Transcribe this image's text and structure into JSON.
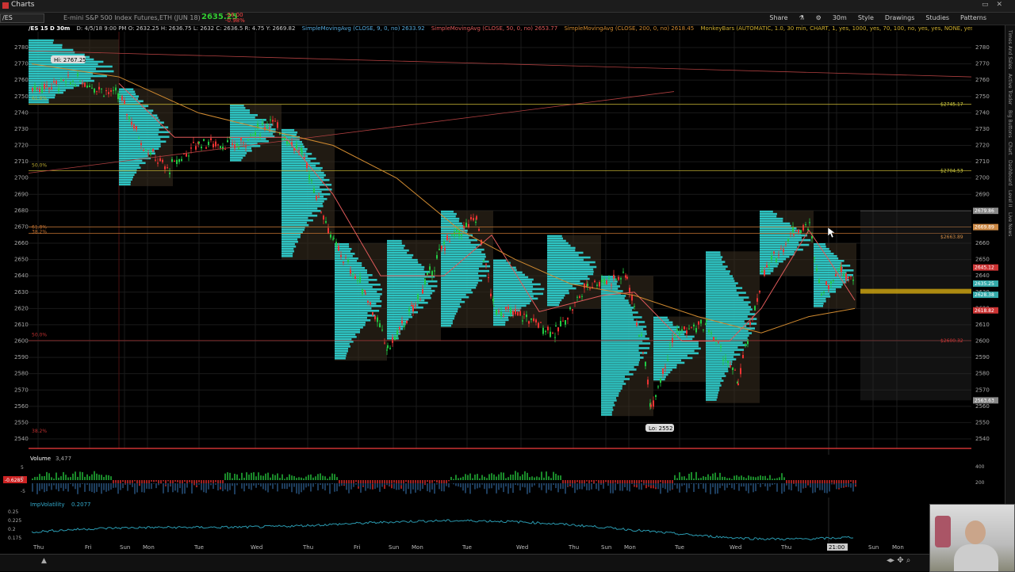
{
  "window": {
    "title": "Charts"
  },
  "toolbar": {
    "symbol": "/ES",
    "description": "E-mini S&P 500 Index Futures,ETH (JUN 18)",
    "last_price": "2635.25",
    "change_line1": "-26.00",
    "change_line2": "-0.98%",
    "buttons": [
      "Share",
      "30m",
      "Style",
      "Drawings",
      "Studies",
      "Patterns"
    ]
  },
  "study_line": {
    "header": "/ES 15 D 30m",
    "ohlc": "D: 4/5/18 9:00 PM  O: 2632.25  H: 2636.75  L: 2632  C: 2636.5  R: 4.75  Y: 2669.82",
    "sma9": "SimpleMovingAvg (CLOSE, 9, 0, no)  2633.92",
    "sma50": "SimpleMovingAvg (CLOSE, 50, 0, no)  2653.77",
    "sma200": "SimpleMovingAvg (CLOSE, 200, 0, no)  2618.45",
    "monkey": "MonkeyBars (AUTOMATIC, 1.0, 30 min, CHART, 1, yes, 1000, yes, 70, 100, no, yes, yes, NONE, yes,..."
  },
  "price_axis": [
    "2780",
    "2770",
    "2760",
    "2750",
    "2740",
    "2730",
    "2720",
    "2710",
    "2700",
    "2690",
    "2680",
    "2670",
    "2660",
    "2650",
    "2640",
    "2630",
    "2620",
    "2610",
    "2600",
    "2590",
    "2580",
    "2570",
    "2560",
    "2550",
    "2540"
  ],
  "price_labels": [
    {
      "text": "$2745.17",
      "color": "#cfcf40"
    },
    {
      "text": "$2704.53",
      "color": "#cfcf40"
    },
    {
      "text": "2679.86",
      "color": "#888"
    },
    {
      "text": "2669.89",
      "color": "#c84"
    },
    {
      "text": "$2663.89",
      "color": "#c84"
    },
    {
      "text": "2645.12",
      "color": "#c33"
    },
    {
      "text": "2635.25",
      "color": "#3aa"
    },
    {
      "text": "2628.38",
      "color": "#3aa"
    },
    {
      "text": "2618.82",
      "color": "#c33"
    },
    {
      "text": "$2600.32",
      "color": "#c33"
    },
    {
      "text": "2563.63",
      "color": "#888"
    }
  ],
  "annotations": {
    "hi": "Hi: 2767.25",
    "lo": "Lo: 2552",
    "fib1": "61.8%",
    "fib2": "50.0%",
    "fib3": "61.8%",
    "fib4": "38.2%",
    "fib5": "50.0%",
    "fib6": "38.2%"
  },
  "volume_panel": {
    "label": "Volume",
    "value": "3,477",
    "axis_value": "-0.6285",
    "axis": [
      "5",
      "0",
      "-5"
    ],
    "right_axis": [
      "400",
      "200"
    ]
  },
  "iv_panel": {
    "label": "ImpVolatility",
    "value": "0.2077",
    "axis": [
      "0.25",
      "0.225",
      "0.2",
      "0.175"
    ]
  },
  "time_axis": [
    "Thu",
    "Fri",
    "Sun",
    "Mon",
    "Tue",
    "Wed",
    "Thu",
    "Fri",
    "Sun",
    "Mon",
    "Tue",
    "Wed",
    "Thu",
    "Sun",
    "Mon",
    "Tue",
    "Wed",
    "Thu",
    "21:00",
    "Sun",
    "Mon"
  ],
  "right_rail": [
    "Times And Sales",
    "Active Trader",
    "Big Buttons",
    "Chart",
    "Dashboard",
    "Level II",
    "Live News"
  ],
  "colors": {
    "profile": "#2fd6d6",
    "bull": "#22cc44",
    "bear": "#ee3333",
    "sma50": "#e05a5a",
    "sma200": "#d08a30",
    "level": "#c8b830",
    "background": "#000000"
  }
}
